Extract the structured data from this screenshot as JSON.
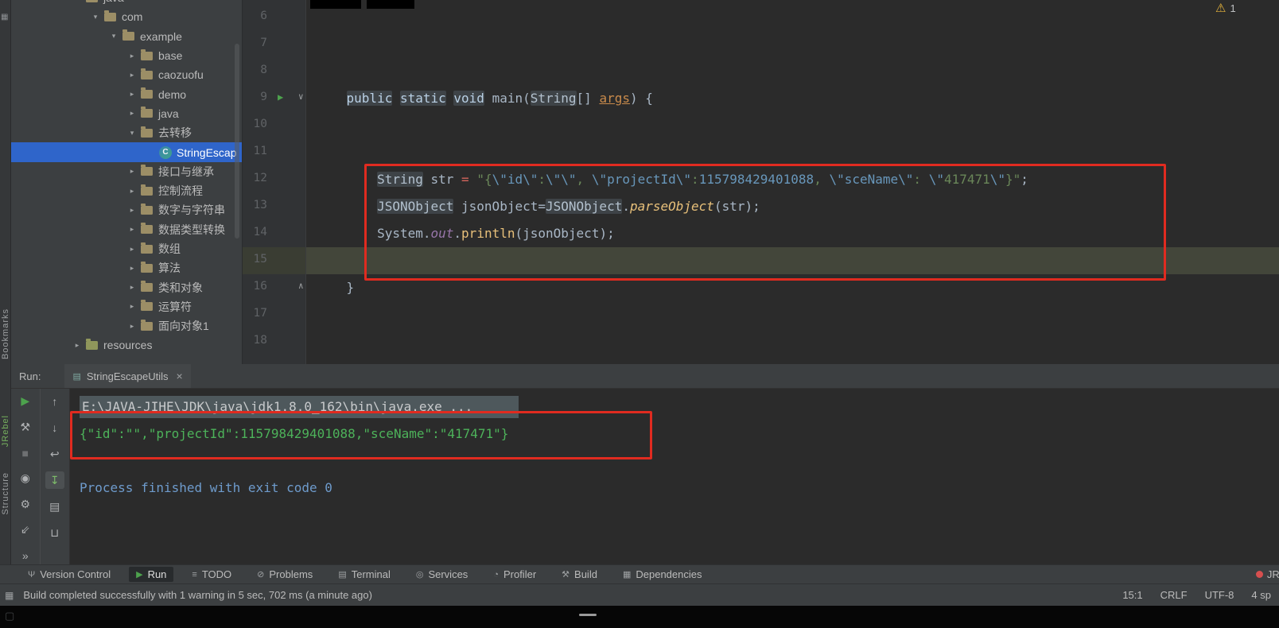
{
  "window": {
    "warning_glyph": "⚠",
    "warning_count": "1"
  },
  "colors": {
    "annotation_red": "#E02B20",
    "tree_selection_blue": "#2F65CA",
    "console_output_green": "#4DB25A",
    "console_exit_blue": "#6E9BCC",
    "run_arrow_green": "#4DA24D"
  },
  "left_strip": {
    "top_icon": "▦",
    "labels": {
      "bookmarks": "Bookmarks",
      "jrebel": "JRebel",
      "structure": "Structure"
    }
  },
  "project_panel": {
    "items": [
      {
        "label": "java",
        "level": 1,
        "chevron": "v",
        "icon": "folder",
        "cut": true
      },
      {
        "label": "com",
        "level": 2,
        "chevron": "v",
        "icon": "folder"
      },
      {
        "label": "example",
        "level": 3,
        "chevron": "v",
        "icon": "folder"
      },
      {
        "label": "base",
        "level": 4,
        "chevron": ">",
        "icon": "folder"
      },
      {
        "label": "caozuofu",
        "level": 4,
        "chevron": ">",
        "icon": "folder"
      },
      {
        "label": "demo",
        "level": 4,
        "chevron": ">",
        "icon": "folder"
      },
      {
        "label": "java",
        "level": 4,
        "chevron": ">",
        "icon": "folder"
      },
      {
        "label": "去转移",
        "level": 4,
        "chevron": "v",
        "icon": "folder"
      },
      {
        "label": "StringEscap",
        "level": 5,
        "chevron": "",
        "icon": "class",
        "selected": true
      },
      {
        "label": "接口与继承",
        "level": 4,
        "chevron": ">",
        "icon": "folder"
      },
      {
        "label": "控制流程",
        "level": 4,
        "chevron": ">",
        "icon": "folder"
      },
      {
        "label": "数字与字符串",
        "level": 4,
        "chevron": ">",
        "icon": "folder"
      },
      {
        "label": "数据类型转换",
        "level": 4,
        "chevron": ">",
        "icon": "folder"
      },
      {
        "label": "数组",
        "level": 4,
        "chevron": ">",
        "icon": "folder"
      },
      {
        "label": "算法",
        "level": 4,
        "chevron": ">",
        "icon": "folder"
      },
      {
        "label": "类和对象",
        "level": 4,
        "chevron": ">",
        "icon": "folder"
      },
      {
        "label": "运算符",
        "level": 4,
        "chevron": ">",
        "icon": "folder"
      },
      {
        "label": "面向对象1",
        "level": 4,
        "chevron": ">",
        "icon": "folder"
      },
      {
        "label": "resources",
        "level": 1,
        "chevron": ">",
        "icon": "resources"
      }
    ]
  },
  "editor": {
    "lines": [
      {
        "num": "6",
        "tokens": []
      },
      {
        "num": "7",
        "tokens": []
      },
      {
        "num": "8",
        "tokens": []
      },
      {
        "num": "9",
        "gutter": "run",
        "tokens": [
          {
            "t": "    ",
            "c": "p"
          },
          {
            "t": "public",
            "c": "kw"
          },
          {
            "t": " ",
            "c": "p"
          },
          {
            "t": "static",
            "c": "kw"
          },
          {
            "t": " ",
            "c": "p"
          },
          {
            "t": "void",
            "c": "kw"
          },
          {
            "t": " main(",
            "c": "p"
          },
          {
            "t": "String",
            "c": "ty"
          },
          {
            "t": "[] ",
            "c": "p"
          },
          {
            "t": "args",
            "c": "par"
          },
          {
            "t": ") {",
            "c": "p"
          }
        ]
      },
      {
        "num": "10",
        "tokens": []
      },
      {
        "num": "11",
        "tokens": []
      },
      {
        "num": "12",
        "tokens": [
          {
            "t": "        ",
            "c": "p"
          },
          {
            "t": "String",
            "c": "ty"
          },
          {
            "t": " str ",
            "c": "p"
          },
          {
            "t": "=",
            "c": "asn"
          },
          {
            "t": " ",
            "c": "p"
          },
          {
            "t": "\"{",
            "c": "str"
          },
          {
            "t": "\\\"id\\\"",
            "c": "esc"
          },
          {
            "t": ":",
            "c": "str"
          },
          {
            "t": "\\\"\\\"",
            "c": "esc"
          },
          {
            "t": ", ",
            "c": "str"
          },
          {
            "t": "\\\"projectId\\\"",
            "c": "esc"
          },
          {
            "t": ":",
            "c": "str"
          },
          {
            "t": "115798429401088",
            "c": "num"
          },
          {
            "t": ", ",
            "c": "str"
          },
          {
            "t": "\\\"sceName\\\"",
            "c": "esc"
          },
          {
            "t": ": ",
            "c": "str"
          },
          {
            "t": "\\\"",
            "c": "esc"
          },
          {
            "t": "417471",
            "c": "str"
          },
          {
            "t": "\\\"",
            "c": "esc"
          },
          {
            "t": "}\"",
            "c": "str"
          },
          {
            "t": ";",
            "c": "p"
          }
        ]
      },
      {
        "num": "13",
        "tokens": [
          {
            "t": "        ",
            "c": "p"
          },
          {
            "t": "JSONObject",
            "c": "ty"
          },
          {
            "t": " jsonObject",
            "c": "p"
          },
          {
            "t": "=",
            "c": "p"
          },
          {
            "t": "JSONObject",
            "c": "ty"
          },
          {
            "t": ".",
            "c": "p"
          },
          {
            "t": "parseObject",
            "c": "mthi"
          },
          {
            "t": "(str)",
            "c": "p"
          },
          {
            "t": ";",
            "c": "p"
          }
        ]
      },
      {
        "num": "14",
        "tokens": [
          {
            "t": "        ",
            "c": "p"
          },
          {
            "t": "System",
            "c": "p"
          },
          {
            "t": ".",
            "c": "p"
          },
          {
            "t": "out",
            "c": "fld"
          },
          {
            "t": ".",
            "c": "p"
          },
          {
            "t": "println",
            "c": "mth"
          },
          {
            "t": "(jsonObject)",
            "c": "p"
          },
          {
            "t": ";",
            "c": "p"
          }
        ]
      },
      {
        "num": "15",
        "current": true,
        "tokens": []
      },
      {
        "num": "16",
        "gutter": "fold",
        "tokens": [
          {
            "t": "    }",
            "c": "p"
          }
        ]
      },
      {
        "num": "17",
        "tokens": []
      },
      {
        "num": "18",
        "tokens": []
      }
    ]
  },
  "run_panel": {
    "label": "Run:",
    "tab": {
      "icon": "▤",
      "title": "StringEscapeUtils",
      "close": "×"
    },
    "toolbar_col1": [
      {
        "name": "rerun-button",
        "glyph": "▶",
        "style": "green"
      },
      {
        "name": "edit-configuration-button",
        "glyph": "⚒",
        "style": ""
      },
      {
        "name": "stop-button",
        "glyph": "■",
        "style": "dim"
      },
      {
        "name": "screenshot-button",
        "glyph": "◉",
        "style": ""
      },
      {
        "name": "coverage-settings-button",
        "glyph": "⚙",
        "style": ""
      },
      {
        "name": "restore-layout-button",
        "glyph": "⇙",
        "style": ""
      },
      {
        "name": "more-options-button",
        "glyph": "»",
        "style": ""
      }
    ],
    "toolbar_col2": [
      {
        "name": "prev-trace-button",
        "glyph": "↑",
        "style": ""
      },
      {
        "name": "next-trace-button",
        "glyph": "↓",
        "style": ""
      },
      {
        "name": "soft-wrap-button",
        "glyph": "↩",
        "style": ""
      },
      {
        "name": "scroll-to-end-button",
        "glyph": "↧",
        "style": "active"
      },
      {
        "name": "print-button",
        "glyph": "▤",
        "style": ""
      },
      {
        "name": "clear-console-button",
        "glyph": "⊔",
        "style": ""
      }
    ],
    "console": {
      "path_line": "E:\\JAVA-JIHE\\JDK\\java\\jdk1.8.0_162\\bin\\java.exe ...",
      "output_line": "{\"id\":\"\",\"projectId\":115798429401088,\"sceName\":\"417471\"}",
      "exit_line": "Process finished with exit code 0"
    }
  },
  "bottom_bar": {
    "tabs": [
      {
        "label": "Version Control",
        "glyph": "Ψ",
        "active": false
      },
      {
        "label": "Run",
        "glyph": "▶",
        "active": true
      },
      {
        "label": "TODO",
        "glyph": "≡",
        "active": false
      },
      {
        "label": "Problems",
        "glyph": "⊘",
        "active": false
      },
      {
        "label": "Terminal",
        "glyph": "▤",
        "active": false
      },
      {
        "label": "Services",
        "glyph": "◎",
        "active": false
      },
      {
        "label": "Profiler",
        "glyph": "◔",
        "active": false
      },
      {
        "label": "Build",
        "glyph": "⚒",
        "active": false
      },
      {
        "label": "Dependencies",
        "glyph": "▦",
        "active": false
      }
    ],
    "right_label": "JRe"
  },
  "status_bar": {
    "toggle_icon": "▦",
    "message": "Build completed successfully with 1 warning in 5 sec, 702 ms (a minute ago)",
    "items": [
      {
        "label": "15:1",
        "name": "caret-position"
      },
      {
        "label": "CRLF",
        "name": "line-ending"
      },
      {
        "label": "UTF-8",
        "name": "encoding"
      },
      {
        "label": "4 sp",
        "name": "indent"
      }
    ]
  }
}
